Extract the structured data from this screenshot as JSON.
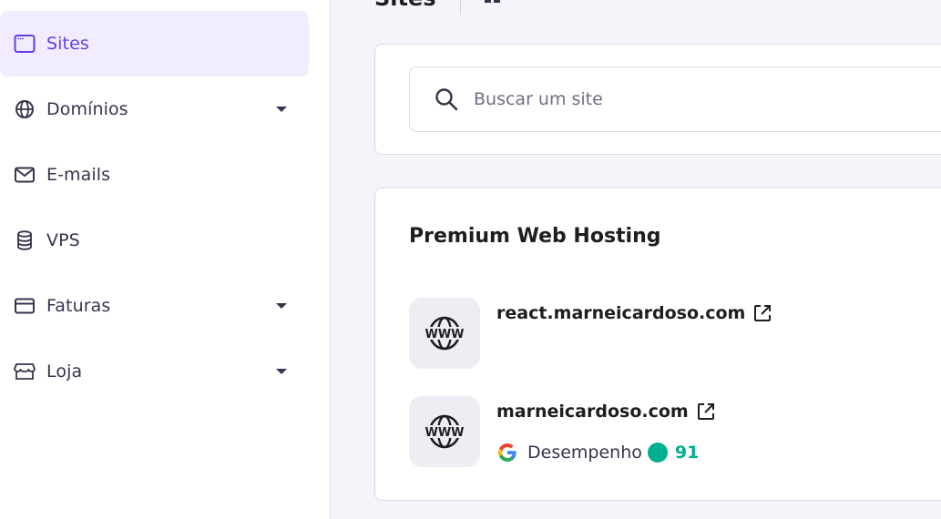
{
  "sidebar": {
    "items": [
      {
        "label": "Sites",
        "icon": "browser-window-icon",
        "active": true,
        "has_caret": false
      },
      {
        "label": "Domínios",
        "icon": "globe-icon",
        "active": false,
        "has_caret": true
      },
      {
        "label": "E-mails",
        "icon": "mail-icon",
        "active": false,
        "has_caret": false
      },
      {
        "label": "VPS",
        "icon": "database-icon",
        "active": false,
        "has_caret": false
      },
      {
        "label": "Faturas",
        "icon": "credit-card-icon",
        "active": false,
        "has_caret": true
      },
      {
        "label": "Loja",
        "icon": "store-icon",
        "active": false,
        "has_caret": true
      }
    ]
  },
  "header": {
    "title": "Sites"
  },
  "search": {
    "placeholder": "Buscar um site"
  },
  "hosting": {
    "title": "Premium Web Hosting",
    "sites": [
      {
        "domain": "react.marneicardoso.com",
        "icon": "www-globe-icon"
      },
      {
        "domain": "marneicardoso.com",
        "icon": "www-globe-icon",
        "performance_label": "Desempenho",
        "performance_score": "91"
      }
    ]
  },
  "colors": {
    "accent": "#673de6",
    "active_bg": "#f1ecff",
    "score_green": "#00b090"
  }
}
